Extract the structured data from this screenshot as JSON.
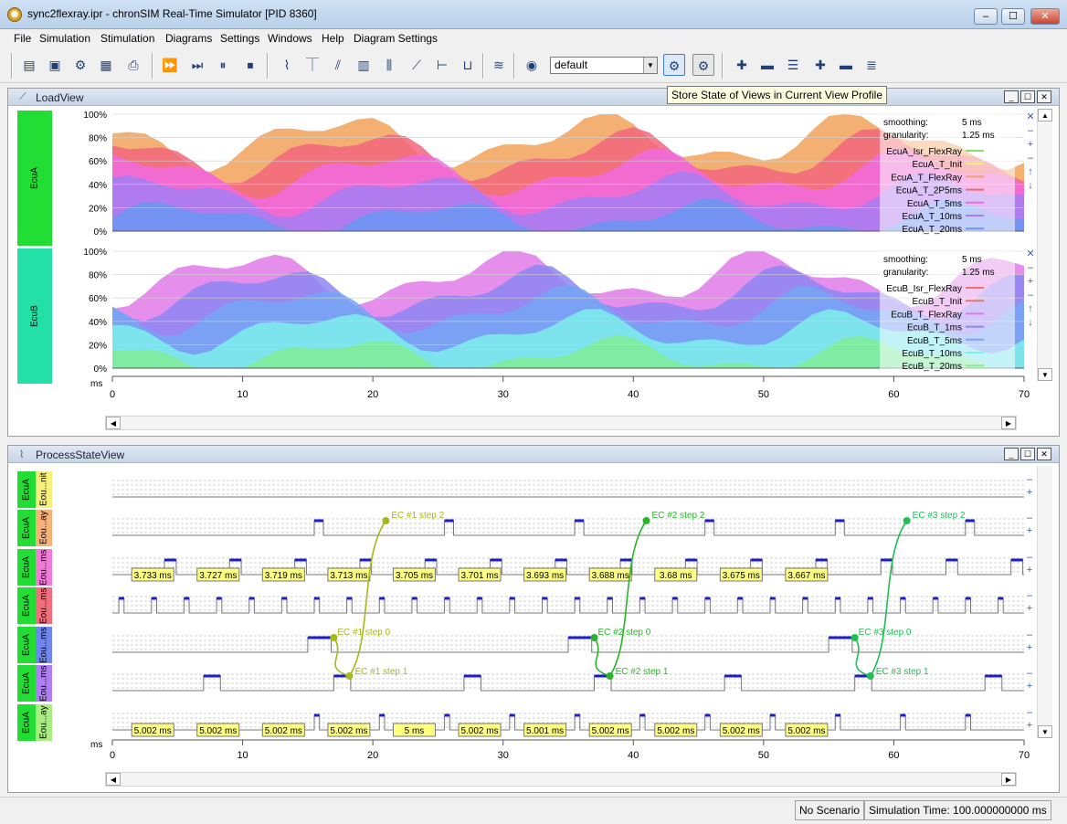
{
  "window": {
    "title": "sync2flexray.ipr - chronSIM Real-Time Simulator [PID 8360]",
    "app_icon": "chronsim-app-icon",
    "min": "–",
    "max": "☐",
    "close": "✕"
  },
  "menu": [
    "File",
    "Simulation",
    "Stimulation",
    "Diagrams",
    "Settings",
    "Windows",
    "Help",
    "Diagram Settings"
  ],
  "toolbar": {
    "profile_value": "default",
    "tooltip": "Store State of Views in Current View Profile"
  },
  "load_view": {
    "title": "LoadView",
    "rows": [
      {
        "label": "EcuA",
        "color": "#22dd33"
      },
      {
        "label": "EcuB",
        "color": "#22e0a6"
      }
    ],
    "y_ticks": [
      "100%",
      "80%",
      "60%",
      "40%",
      "20%",
      "0%"
    ],
    "x_unit": "ms",
    "x_ticks": [
      "0",
      "10",
      "20",
      "30",
      "40",
      "50",
      "60",
      "70"
    ],
    "legends": [
      {
        "smoothing_label": "smoothing:",
        "smoothing_value": "5 ms",
        "granularity_label": "granularity:",
        "granularity_value": "1.25 ms",
        "items": [
          "EcuA_Isr_FlexRay",
          "EcuA_T_Init",
          "EcuA_T_FlexRay",
          "EcuA_T_2P5ms",
          "EcuA_T_5ms",
          "EcuA_T_10ms",
          "EcuA_T_20ms"
        ],
        "item_colors": [
          "#8be06b",
          "#f7f07a",
          "#f2a25b",
          "#f2667c",
          "#f06ae0",
          "#a57ef4",
          "#6a96f2"
        ]
      },
      {
        "smoothing_label": "smoothing:",
        "smoothing_value": "5 ms",
        "granularity_label": "granularity:",
        "granularity_value": "1.25 ms",
        "items": [
          "EcuB_Isr_FlexRay",
          "EcuB_T_Init",
          "EcuB_T_FlexRay",
          "EcuB_T_1ms",
          "EcuB_T_5ms",
          "EcuB_T_10ms",
          "EcuB_T_20ms"
        ],
        "item_colors": [
          "#f27070",
          "#f27070",
          "#e07ae8",
          "#8e86f2",
          "#76a6f4",
          "#7ef0ec",
          "#80ec94"
        ]
      }
    ]
  },
  "process_view": {
    "title": "ProcessStateView",
    "rows": [
      {
        "ecu": "EcuA",
        "task": "Eou...nit",
        "color": "#f7f07a"
      },
      {
        "ecu": "EcuA",
        "task": "Eou...ay",
        "color": "#f7b27a"
      },
      {
        "ecu": "EcuA",
        "task": "Eou...ms",
        "color": "#f27bd8"
      },
      {
        "ecu": "EcuA",
        "task": "Eou...ms",
        "color": "#f26e7c"
      },
      {
        "ecu": "EcuA",
        "task": "Eou...ms",
        "color": "#6f86f0"
      },
      {
        "ecu": "EcuA",
        "task": "Eou...ms",
        "color": "#b07ef4"
      },
      {
        "ecu": "EcuA",
        "task": "Eou...ay",
        "color": "#a8ec82"
      }
    ],
    "event_chains": [
      {
        "step2": "EC #1 step 2",
        "step0": "EC #1 step 0",
        "step1": "EC #1 step 1",
        "color": "#a6b81a"
      },
      {
        "step2": "EC #2 step 2",
        "step0": "EC #2 step 0",
        "step1": "EC #2 step 1",
        "color": "#2bb42b"
      },
      {
        "step2": "EC #3 step 2",
        "step0": "EC #3 step 0",
        "step1": "EC #3 step 1",
        "color": "#1fbf55"
      }
    ],
    "row3_durations": [
      "3.733 ms",
      "3.727 ms",
      "3.719 ms",
      "3.713 ms",
      "3.705 ms",
      "3.701 ms",
      "3.693 ms",
      "3.688 ms",
      "3.68 ms",
      "3.675 ms",
      "3.667 ms"
    ],
    "row7_durations": [
      "5.002 ms",
      "5.002 ms",
      "5.002 ms",
      "5.002 ms",
      "5 ms",
      "5.002 ms",
      "5.001 ms",
      "5.002 ms",
      "5.002 ms",
      "5.002 ms",
      "5.002 ms"
    ],
    "x_unit": "ms",
    "x_ticks": [
      "0",
      "10",
      "20",
      "30",
      "40",
      "50",
      "60",
      "70"
    ]
  },
  "status": {
    "scenario": "No Scenario",
    "sim_time": "Simulation Time: 100.000000000 ms"
  }
}
